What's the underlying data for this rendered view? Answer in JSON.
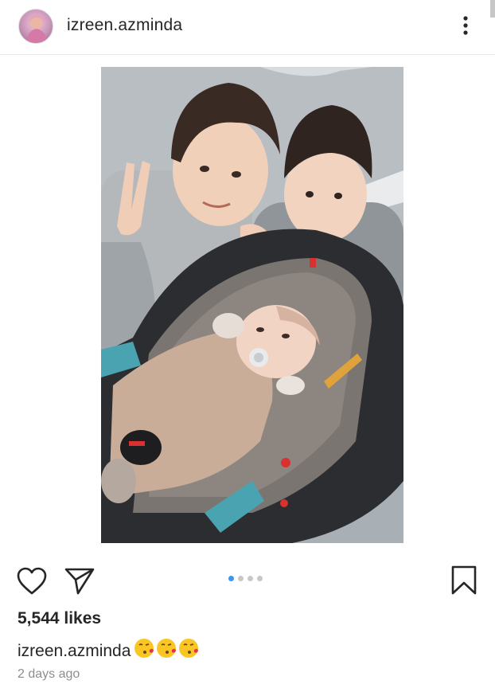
{
  "post": {
    "username": "izreen.azminda",
    "likes": "5,544 likes",
    "caption_user": "izreen.azminda",
    "caption_emojis": [
      "kissing-face-emoji",
      "kissing-face-emoji",
      "kissing-face-emoji"
    ],
    "timestamp": "2 days ago",
    "carousel": {
      "total": 4,
      "active_index": 0
    }
  },
  "icons": {
    "more": "more-vertical-icon",
    "like": "heart-icon",
    "share": "send-icon",
    "save": "bookmark-icon"
  },
  "colors": {
    "text": "#262626",
    "muted": "#8e8e8e",
    "active_dot": "#3897f0",
    "inactive_dot": "#c8c8c8"
  }
}
